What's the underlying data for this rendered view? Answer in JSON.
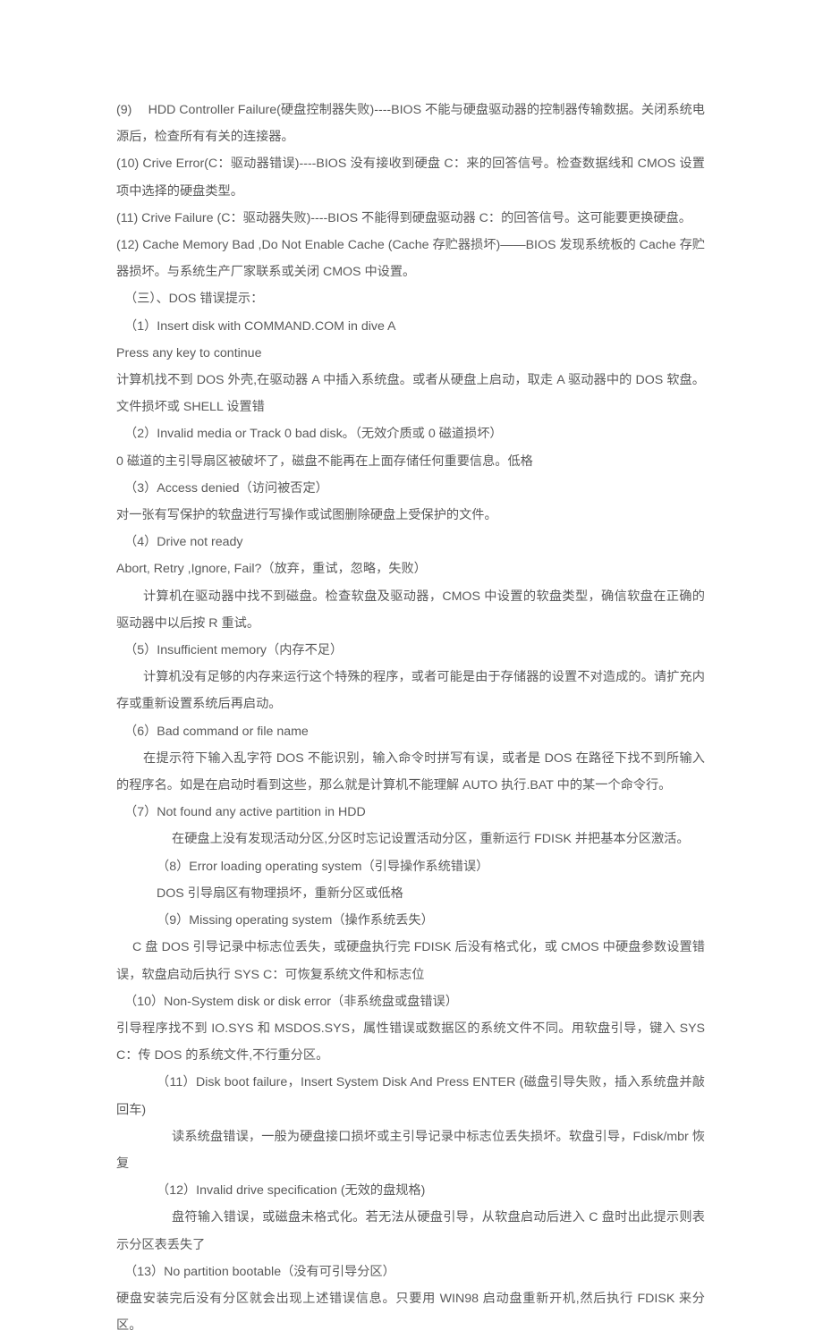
{
  "document": {
    "background_color": "#ffffff",
    "text_color": "#595959",
    "paragraphs": [
      {
        "id": "p01",
        "indent": "ind0",
        "text": "(9)　 HDD Controller Failure(硬盘控制器失败)----BIOS 不能与硬盘驱动器的控制器传输数据。关闭系统电源后，检查所有有关的连接器。"
      },
      {
        "id": "p02",
        "indent": "ind0",
        "text": "(10) Crive Error(C：驱动器错误)----BIOS 没有接收到硬盘 C：来的回答信号。检查数据线和 CMOS 设置项中选择的硬盘类型。"
      },
      {
        "id": "p03",
        "indent": "ind0",
        "text": "(11) Crive Failure (C：驱动器失败)----BIOS 不能得到硬盘驱动器 C：的回答信号。这可能要更换硬盘。"
      },
      {
        "id": "p04",
        "indent": "ind0",
        "text": "(12) Cache Memory Bad ,Do Not Enable Cache (Cache 存贮器损坏)——BIOS 发现系统板的 Cache 存贮器损坏。与系统生产厂家联系或关闭 CMOS 中设置。"
      },
      {
        "id": "p05",
        "indent": "ind1",
        "text": "（三）、DOS 错误提示："
      },
      {
        "id": "p06",
        "indent": "ind1",
        "text": "（1）Insert disk with COMMAND.COM in dive A"
      },
      {
        "id": "p07",
        "indent": "ind0",
        "text": "Press any key to continue"
      },
      {
        "id": "p08",
        "indent": "ind0",
        "text": "计算机找不到 DOS 外壳,在驱动器 A 中插入系统盘。或者从硬盘上启动，取走 A 驱动器中的 DOS 软盘。文件损坏或 SHELL 设置错"
      },
      {
        "id": "p09",
        "indent": "ind1",
        "text": "（2）Invalid media or Track 0 bad disk。（无效介质或 0 磁道损坏）"
      },
      {
        "id": "p10",
        "indent": "ind0",
        "text": "0 磁道的主引导扇区被破坏了，磁盘不能再在上面存储任何重要信息。低格"
      },
      {
        "id": "p11",
        "indent": "ind1",
        "text": "（3）Access denied（访问被否定）"
      },
      {
        "id": "p12",
        "indent": "ind0",
        "text": "对一张有写保护的软盘进行写操作或试图删除硬盘上受保护的文件。"
      },
      {
        "id": "p13",
        "indent": "ind1",
        "text": "（4）Drive not ready"
      },
      {
        "id": "p14",
        "indent": "ind0",
        "text": "Abort, Retry ,Ignore, Fail?（放弃，重试，忽略，失败）"
      },
      {
        "id": "p15",
        "indent": "ind3",
        "text": "计算机在驱动器中找不到磁盘。检查软盘及驱动器，CMOS 中设置的软盘类型，确信软盘在正确的驱动器中以后按 R 重试。"
      },
      {
        "id": "p16",
        "indent": "ind1",
        "text": "（5）Insufficient memory（内存不足）"
      },
      {
        "id": "p17",
        "indent": "ind3",
        "text": "计算机没有足够的内存来运行这个特殊的程序，或者可能是由于存储器的设置不对造成的。请扩充内存或重新设置系统后再启动。"
      },
      {
        "id": "p18",
        "indent": "ind1",
        "text": "（6）Bad command or file name"
      },
      {
        "id": "p19",
        "indent": "ind3",
        "text": "在提示符下输入乱字符 DOS 不能识别，输入命令时拼写有误，或者是 DOS 在路径下找不到所输入的程序名。如是在启动时看到这些，那么就是计算机不能理解 AUTO 执行.BAT 中的某一个命令行。"
      },
      {
        "id": "p20",
        "indent": "ind1",
        "text": "（7）Not found any active partition in HDD"
      },
      {
        "id": "p21",
        "indent": "ind5",
        "text": "在硬盘上没有发现活动分区,分区时忘记设置活动分区，重新运行 FDISK 并把基本分区激活。"
      },
      {
        "id": "p22",
        "indent": "ind4",
        "text": "（8）Error loading operating system（引导操作系统错误）"
      },
      {
        "id": "p23",
        "indent": "ind4",
        "text": "DOS 引导扇区有物理损坏，重新分区或低格"
      },
      {
        "id": "p24",
        "indent": "ind4",
        "text": "（9）Missing operating system（操作系统丢失）"
      },
      {
        "id": "p25",
        "indent": "ind2",
        "text": "C 盘 DOS 引导记录中标志位丢失，或硬盘执行完 FDISK 后没有格式化，或 CMOS 中硬盘参数设置错误，软盘启动后执行 SYS C：可恢复系统文件和标志位"
      },
      {
        "id": "p26",
        "indent": "ind1",
        "text": "（10）Non-System disk or disk error（非系统盘或盘错误）"
      },
      {
        "id": "p27",
        "indent": "ind0",
        "text": "引导程序找不到 IO.SYS 和 MSDOS.SYS，属性错误或数据区的系统文件不同。用软盘引导，键入 SYS C：传 DOS 的系统文件,不行重分区。"
      },
      {
        "id": "p28",
        "indent": "ind4",
        "text": "（11）Disk boot failure，Insert System Disk And Press ENTER (磁盘引导失败，插入系统盘并敲回车)"
      },
      {
        "id": "p29",
        "indent": "ind5",
        "text": "读系统盘错误，一般为硬盘接口损坏或主引导记录中标志位丢失损坏。软盘引导，Fdisk/mbr 恢复"
      },
      {
        "id": "p30",
        "indent": "ind4",
        "text": "（12）Invalid drive specification (无效的盘规格)"
      },
      {
        "id": "p31",
        "indent": "ind5",
        "text": "盘符输入错误，或磁盘未格式化。若无法从硬盘引导，从软盘启动后进入 C 盘时出此提示则表示分区表丢失了"
      },
      {
        "id": "p32",
        "indent": "ind1",
        "text": "（13）No partition bootable（没有可引导分区）"
      },
      {
        "id": "p33",
        "indent": "ind0",
        "text": "硬盘安装完后没有分区就会出现上述错误信息。只要用 WIN98 启动盘重新开机,然后执行 FDISK 来分区。"
      }
    ]
  }
}
